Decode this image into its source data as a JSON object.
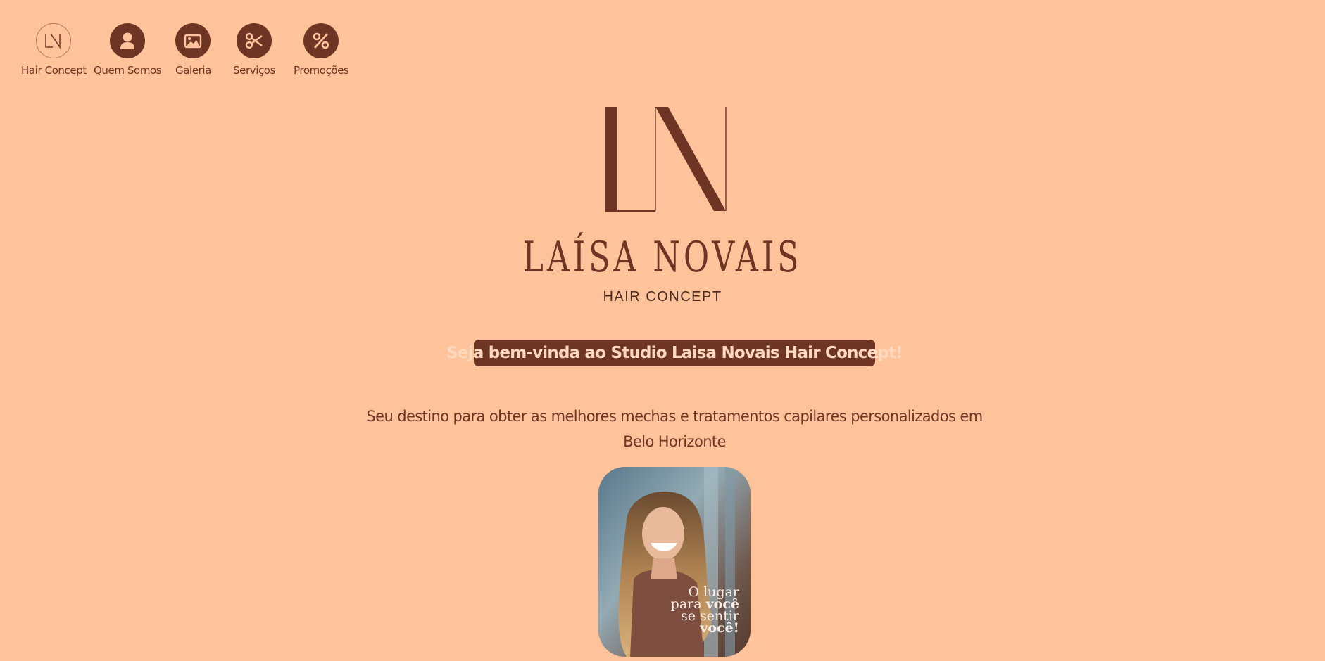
{
  "nav": {
    "items": [
      {
        "label": "Hair Concept",
        "icon": "ln-logo-icon"
      },
      {
        "label": "Quem Somos",
        "icon": "user-icon"
      },
      {
        "label": "Galeria",
        "icon": "image-icon"
      },
      {
        "label": "Serviços",
        "icon": "scissors-icon"
      },
      {
        "label": "Promoções",
        "icon": "percent-icon"
      }
    ]
  },
  "brand": {
    "monogram": "LN",
    "name": "LAÍSA NOVAIS",
    "subtitle": "HAIR CONCEPT"
  },
  "welcome": "Seja bem-vinda ao Studio Laisa Novais Hair Concept!",
  "tagline": "Seu destino para obter as melhores mechas e tratamentos capilares personalizados em Belo Horizonte",
  "hero": {
    "caption_line1": "O lugar",
    "caption_line2_a": "para",
    "caption_line2_b": "você",
    "caption_line3": "se sentir",
    "caption_line4": "você!"
  },
  "colors": {
    "background": "#FFC39B",
    "accent": "#6E3524",
    "welcome_text": "#FFD9BE"
  }
}
